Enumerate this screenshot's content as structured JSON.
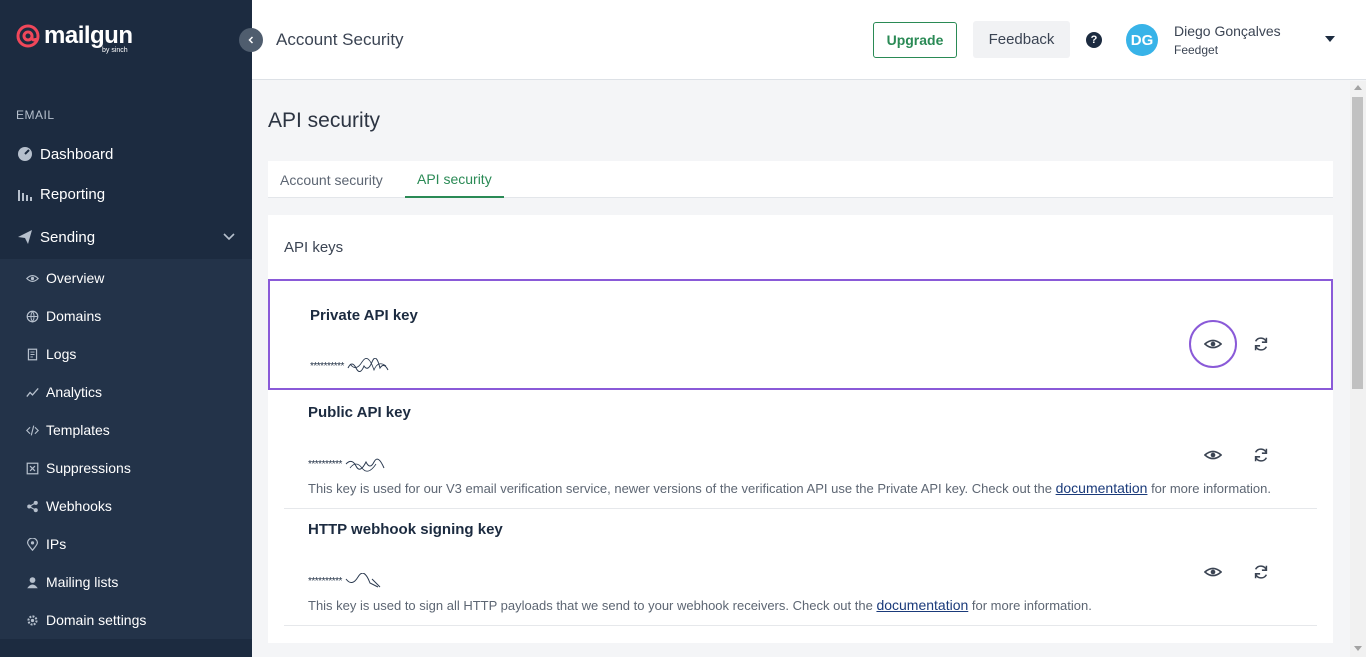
{
  "brand": {
    "name": "mailgun",
    "sub": "by sinch",
    "accent": "#f0475a"
  },
  "sidebar": {
    "section_label": "EMAIL",
    "main_items": [
      {
        "label": "Dashboard",
        "icon": "dashboard-icon"
      },
      {
        "label": "Reporting",
        "icon": "reporting-icon"
      },
      {
        "label": "Sending",
        "icon": "sending-icon"
      }
    ],
    "sub_items": [
      {
        "label": "Overview",
        "icon": "eye-icon"
      },
      {
        "label": "Domains",
        "icon": "globe-icon"
      },
      {
        "label": "Logs",
        "icon": "logs-icon"
      },
      {
        "label": "Analytics",
        "icon": "analytics-icon"
      },
      {
        "label": "Templates",
        "icon": "code-icon"
      },
      {
        "label": "Suppressions",
        "icon": "suppressions-icon"
      },
      {
        "label": "Webhooks",
        "icon": "webhooks-icon"
      },
      {
        "label": "IPs",
        "icon": "location-pin-icon"
      },
      {
        "label": "Mailing lists",
        "icon": "user-icon"
      },
      {
        "label": "Domain settings",
        "icon": "gear-icon"
      }
    ]
  },
  "header": {
    "title": "Account Security",
    "upgrade_label": "Upgrade",
    "feedback_label": "Feedback",
    "help_label": "?",
    "avatar_initials": "DG",
    "user_name": "Diego Gonçalves",
    "user_org": "Feedget"
  },
  "main": {
    "page_title": "API security",
    "tabs": [
      {
        "label": "Account security",
        "active": false
      },
      {
        "label": "API security",
        "active": true
      }
    ],
    "card_title": "API keys",
    "keys": [
      {
        "name": "Private API key",
        "masked": "**********",
        "description": "",
        "link": "",
        "suffix": ""
      },
      {
        "name": "Public API key",
        "masked": "**********",
        "description": "This key is used for our V3 email verification service, newer versions of the verification API use the Private API key. Check out the ",
        "link": "documentation",
        "suffix": " for more information."
      },
      {
        "name": "HTTP webhook signing key",
        "masked": "**********",
        "description": "This key is used to sign all HTTP payloads that we send to your webhook receivers. Check out the ",
        "link": "documentation",
        "suffix": " for more information."
      }
    ]
  },
  "colors": {
    "sidebar_bg": "#1c2b40",
    "sidebar_sub_bg": "#233349",
    "success_green": "#2a8a55",
    "highlight_purple": "#8a5ad8",
    "avatar_blue": "#38b3e8"
  }
}
